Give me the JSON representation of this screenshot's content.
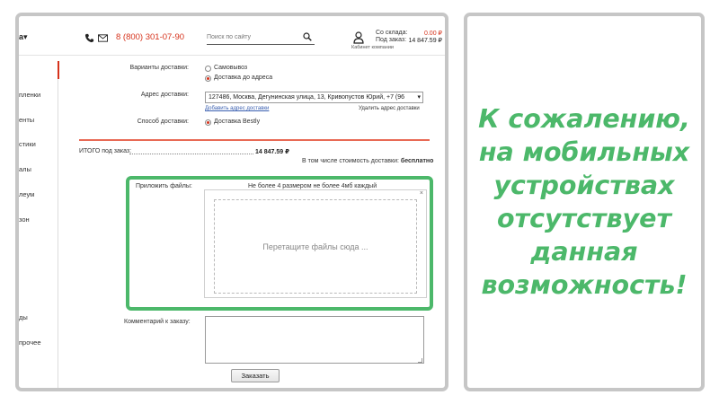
{
  "header": {
    "cut_menu": "а",
    "phone": "8 (800) 301-07-90",
    "search_placeholder": "Поиск по сайту",
    "stock_label": "Со склада:",
    "stock_amount": "0.00 ₽",
    "order_label": "Под заказ:",
    "order_amount": "14 847.59 ₽",
    "cabinet": "Кабинет компании"
  },
  "sidebar": {
    "items": [
      "пленки",
      "енты",
      "стики",
      "алы",
      "леум",
      "зон",
      "",
      "ды",
      "прочее"
    ]
  },
  "form": {
    "delivery_label": "Варианты доставки:",
    "option_pickup": "Самовывоз",
    "option_address": "Доставка до адреса",
    "address_label": "Адрес доставки:",
    "address_value": "127486, Москва, Дегунинская улица, 13, Кривопустов Юрий, +7 (96",
    "add_address": "Добавить адрес доставки",
    "delete_address": "Удалить адрес доставки",
    "method_label": "Способ доставки:",
    "method_value": "Доставка Bestly",
    "total_label": "ИТОГО под заказ:",
    "total_value": "14 847.59 ₽",
    "shipping_note": "В том числе стоимость доставки:",
    "shipping_free": "бесплатно",
    "files_label": "Приложить файлы:",
    "files_hint": "Не более 4 размером не более 4мб каждый",
    "files_close": "×",
    "dropzone_text": "Перетащите файлы сюда ...",
    "comment_label": "Комментарий к заказу:",
    "submit": "Заказать"
  },
  "message": {
    "lines": [
      "К сожалению,",
      "на мобильных",
      "устройствах",
      "отсутствует",
      "данная",
      "возможность!"
    ]
  },
  "colors": {
    "accent_red": "#d6321b",
    "highlight_green": "#4cb86a",
    "panel_border": "#c6c6c6"
  },
  "icons": {
    "phone": "phone-icon",
    "mail": "mail-icon",
    "search": "search-icon",
    "user": "user-icon",
    "chevron": "chevron-down-icon",
    "close": "close-icon"
  }
}
